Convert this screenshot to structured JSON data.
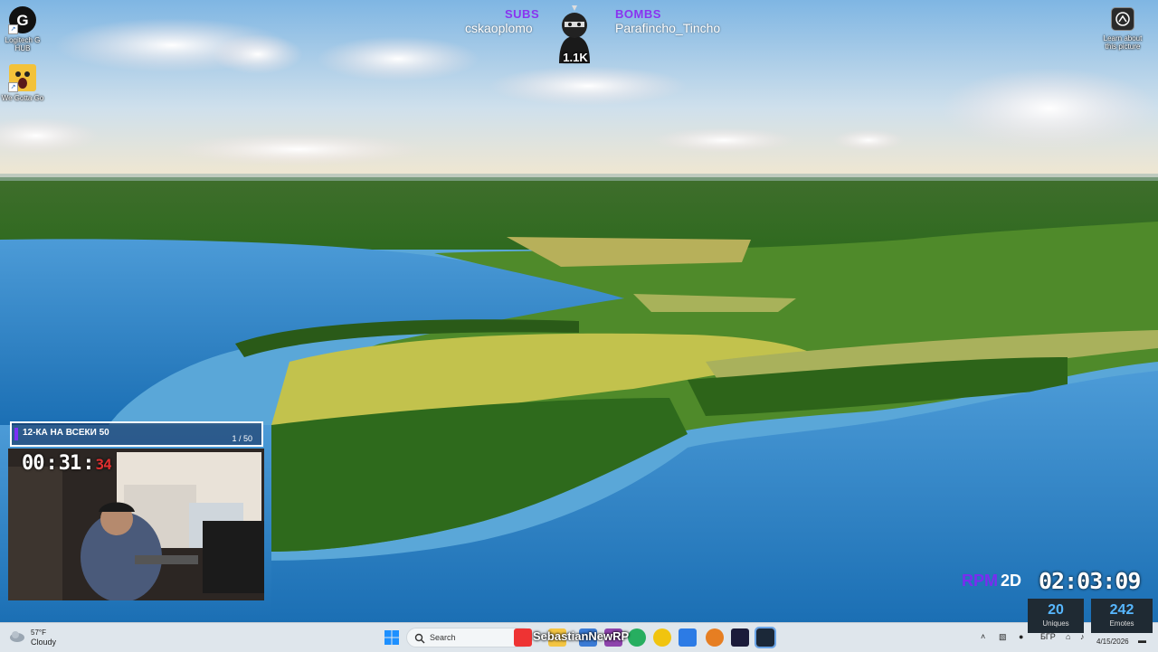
{
  "desktop": {
    "icons": [
      {
        "label": "Logitech G HUB"
      },
      {
        "label": "We Gotta Go"
      }
    ],
    "learn_label": "Learn about this picture"
  },
  "overlay": {
    "subs_heading": "SUBS",
    "subs_name": "cskaoplomo",
    "bombs_heading": "BOMBS",
    "bombs_name": "Parafincho_Tincho",
    "mascot_count": "1.1K",
    "challenge_title": "12-КА НА ВСЕКИ 50",
    "challenge_progress": "1 / 50",
    "cam_timer": {
      "hh": "00",
      "mm": "31",
      "ss": "34"
    },
    "rpm_label": "RPM",
    "rpm_value": "2D",
    "big_clock": "02:03:09",
    "stats": [
      {
        "value": "20",
        "label": "Uniques"
      },
      {
        "value": "242",
        "label": "Emotes"
      }
    ],
    "colors": {
      "accent_purple": "#8a33f0",
      "stat_blue": "#57b7ff",
      "timer_red": "#e03030"
    }
  },
  "taskbar": {
    "weather_temp": "57°F",
    "weather_cond": "Cloudy",
    "search_placeholder": "Search",
    "channel_name": "SebastianNewRP",
    "language": "БГР",
    "date": "4/15/2026",
    "apps": [
      "file-explorer-icon",
      "youtube-icon",
      "store-icon",
      "mail-icon",
      "chrome-icon",
      "discord-icon",
      "app-icon",
      "premiere-icon",
      "steam-icon"
    ]
  }
}
